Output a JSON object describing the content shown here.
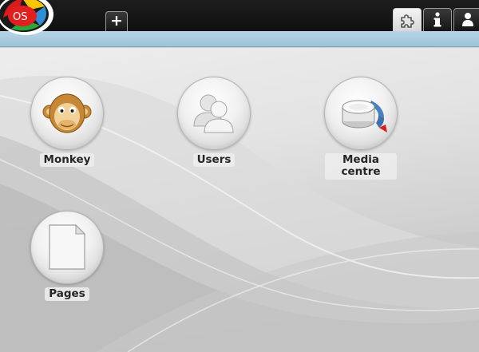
{
  "logo": {
    "text": "OS"
  },
  "tabs": {
    "add_label": "+"
  },
  "topbar_icons": [
    "puzzle-icon",
    "info-icon",
    "user-icon"
  ],
  "apps": [
    {
      "label": "Monkey",
      "icon": "monkey-icon"
    },
    {
      "label": "Users",
      "icon": "users-icon"
    },
    {
      "label": "Media centre",
      "icon": "media-centre-icon"
    },
    {
      "label": "Pages",
      "icon": "page-icon"
    }
  ]
}
